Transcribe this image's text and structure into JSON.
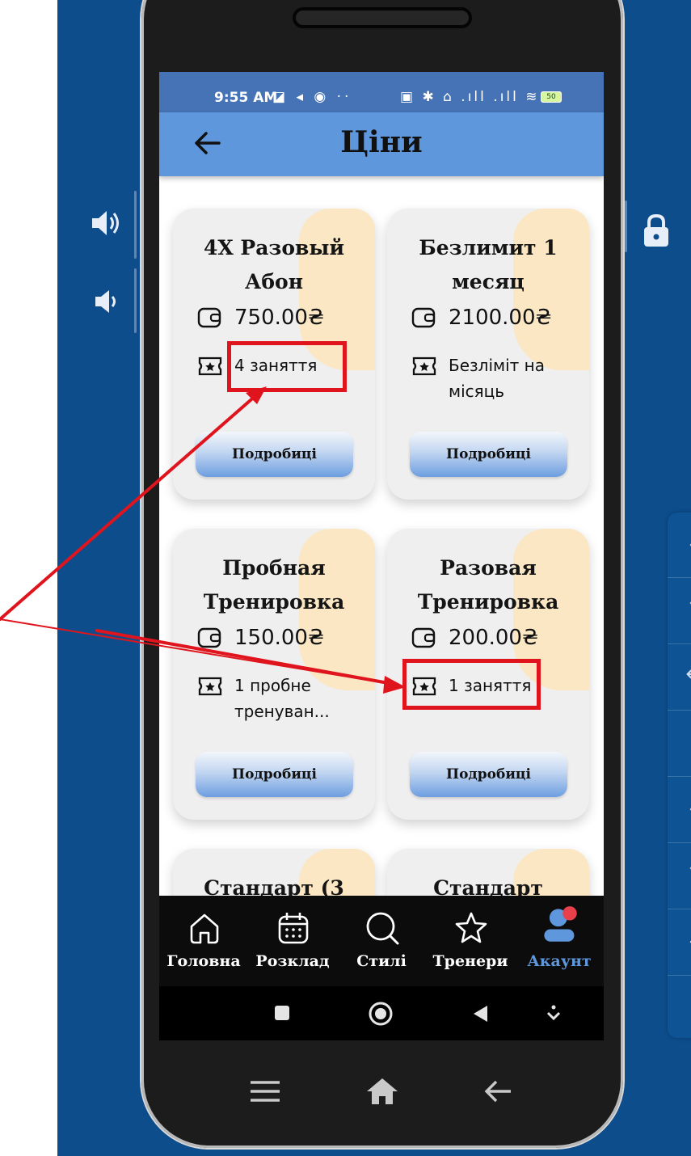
{
  "status_bar": {
    "time": "9:55 AM",
    "left_icons": "◪ ◂ ◉ ··",
    "right_icons": "▣ ✱ ⌂ .ıll .ıll ≋",
    "battery": "50"
  },
  "app_bar": {
    "title": "Ціни",
    "back_icon": "arrow-left-icon"
  },
  "cards": [
    {
      "title": "4X Разовый Абон",
      "price": "750.00₴",
      "lessons": "4 заняття",
      "button": "Подробиці"
    },
    {
      "title": "Безлимит 1 месяц",
      "price": "2100.00₴",
      "lessons": "Безлiмiт на мiсяць",
      "button": "Подробиці"
    },
    {
      "title": "Пробная Тренировка",
      "price": "150.00₴",
      "lessons": "1 пробне тренуван...",
      "button": "Подробиці"
    },
    {
      "title": "Разовая Тренировка",
      "price": "200.00₴",
      "lessons": "1 заняття",
      "button": "Подробиці"
    },
    {
      "title": "Стандарт (3"
    },
    {
      "title": "Стандарт"
    }
  ],
  "bottom_nav": [
    {
      "label": "Головна",
      "icon": "home-icon"
    },
    {
      "label": "Розклад",
      "icon": "calendar-icon"
    },
    {
      "label": "Стилі",
      "icon": "search-icon"
    },
    {
      "label": "Тренери",
      "icon": "star-icon"
    },
    {
      "label": "Акаунт",
      "icon": "account-icon",
      "active": true
    }
  ],
  "colors": {
    "background": "#0d4d8c",
    "status_bar": "#4673b5",
    "app_bar": "#5f97dc",
    "card": "#efeff0",
    "card_accent": "#fbe7c3",
    "active_nav": "#5f97dc",
    "annotation": "#e0141c"
  }
}
